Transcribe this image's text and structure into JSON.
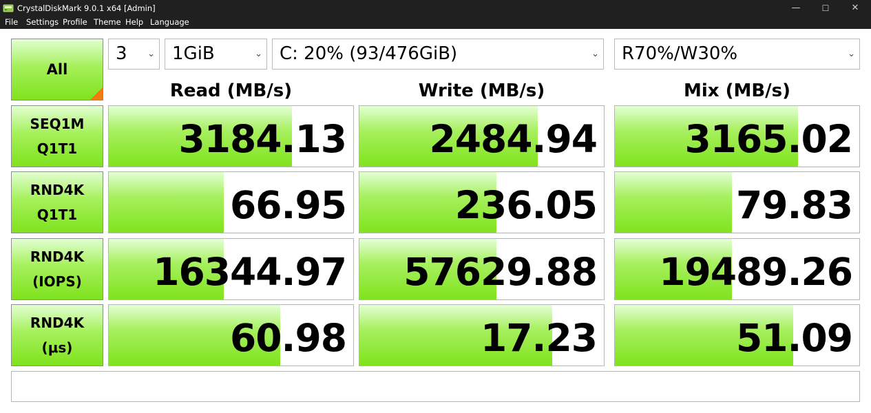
{
  "window": {
    "title": "CrystalDiskMark 9.0.1 x64 [Admin]",
    "controls": {
      "minimize": "—",
      "maximize": "☐",
      "close": "✕"
    }
  },
  "menu": [
    "File",
    "Settings",
    "Profile",
    "Theme",
    "Help",
    "Language"
  ],
  "toolbar": {
    "all_label": "All",
    "test_count": "3",
    "test_size": "1GiB",
    "drive": "C: 20% (93/476GiB)",
    "mix_ratio": "R70%/W30%"
  },
  "columns": {
    "read": "Read (MB/s)",
    "write": "Write (MB/s)",
    "mix": "Mix (MB/s)"
  },
  "rows": [
    {
      "line1": "SEQ1M",
      "line2": "Q1T1",
      "read": {
        "value": "3184.13",
        "level": 0.75
      },
      "write": {
        "value": "2484.94",
        "level": 0.73
      },
      "mix": {
        "value": "3165.02",
        "level": 0.75
      }
    },
    {
      "line1": "RND4K",
      "line2": "Q1T1",
      "read": {
        "value": "66.95",
        "level": 0.47
      },
      "write": {
        "value": "236.05",
        "level": 0.56
      },
      "mix": {
        "value": "79.83",
        "level": 0.48
      }
    },
    {
      "line1": "RND4K",
      "line2": "(IOPS)",
      "read": {
        "value": "16344.97",
        "level": 0.47
      },
      "write": {
        "value": "57629.88",
        "level": 0.56
      },
      "mix": {
        "value": "19489.26",
        "level": 0.48
      }
    },
    {
      "line1": "RND4K",
      "line2": "(μs)",
      "read": {
        "value": "60.98",
        "level": 0.7
      },
      "write": {
        "value": "17.23",
        "level": 0.79
      },
      "mix": {
        "value": "51.09",
        "level": 0.73
      }
    }
  ],
  "comment": "",
  "colors": {
    "titlebar": "#202020",
    "bar_green": "#7fe31d",
    "corner_orange": "#f07c0f"
  },
  "icons": {
    "app": "crystaldiskmark-disk-icon",
    "dropdown": "chevron-down-icon"
  }
}
